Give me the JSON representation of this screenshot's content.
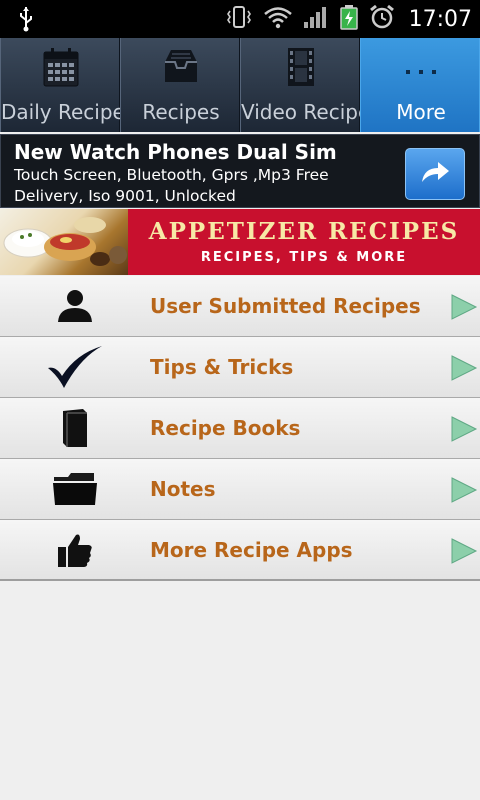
{
  "status_bar": {
    "time": "17:07"
  },
  "tabs": [
    {
      "label": "Daily Recipes",
      "icon": "calendar-icon",
      "selected": false
    },
    {
      "label": "Recipes",
      "icon": "inbox-tray-icon",
      "selected": false
    },
    {
      "label": "Video Recipe",
      "icon": "film-strip-icon",
      "selected": false
    },
    {
      "label": "More",
      "icon": "more-dots-icon",
      "selected": true
    }
  ],
  "ad": {
    "title": "New Watch Phones Dual Sim",
    "description": "Touch Screen, Bluetooth, Gprs ,Mp3 Free Delivery, Iso 9001, Unlocked"
  },
  "banner": {
    "title": "APPETIZER RECIPES",
    "subtitle": "RECIPES, TIPS & MORE"
  },
  "menu": [
    {
      "label": "User Submitted Recipes",
      "icon": "user-silhouette-icon"
    },
    {
      "label": "Tips & Tricks",
      "icon": "checkmark-icon"
    },
    {
      "label": "Recipe Books",
      "icon": "book-icon"
    },
    {
      "label": "Notes",
      "icon": "folder-icon"
    },
    {
      "label": "More Recipe Apps",
      "icon": "thumbs-up-icon"
    }
  ],
  "colors": {
    "tab_selected": "#2a86d6",
    "menu_text": "#b8661a",
    "banner_red": "#c8102e",
    "arrow_green": "#7fc8a0"
  }
}
